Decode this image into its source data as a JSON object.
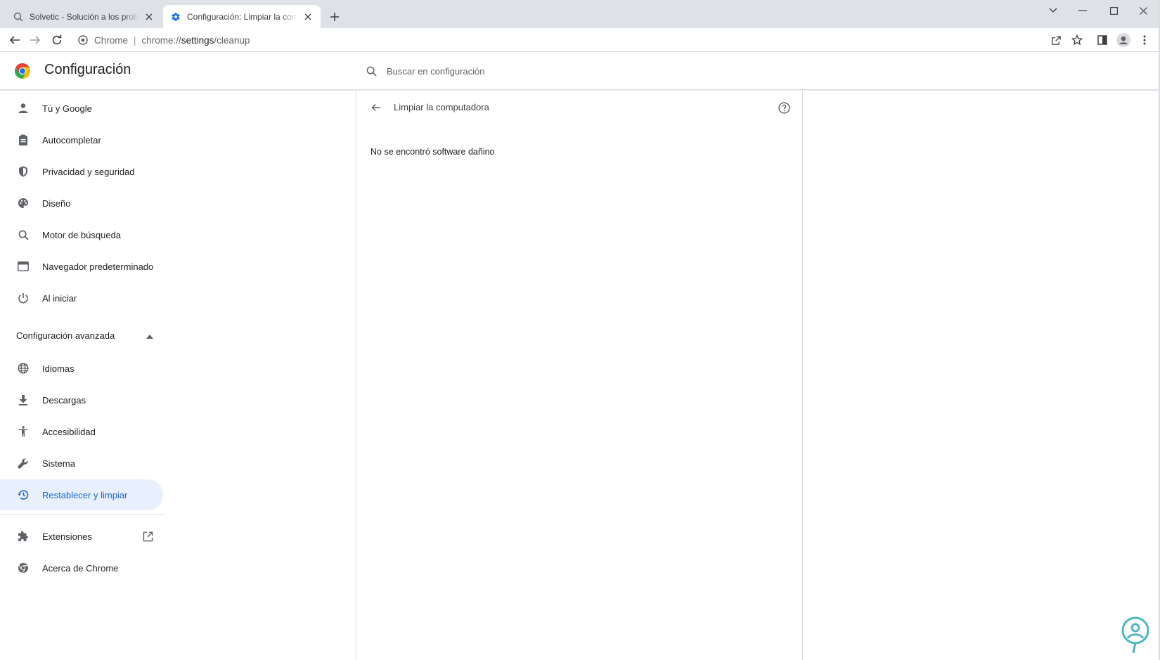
{
  "tabs": [
    {
      "title": "Solvetic - Solución a los problemas informáticos",
      "icon": "search-favicon-icon",
      "active": false
    },
    {
      "title": "Configuración: Limpiar la computadora",
      "icon": "gear-icon",
      "active": true
    }
  ],
  "toolbar": {
    "site_label": "Chrome",
    "url_scheme": "chrome://",
    "url_host": "settings",
    "url_path": "/cleanup"
  },
  "header": {
    "title": "Configuración",
    "search_placeholder": "Buscar en configuración"
  },
  "sidebar": {
    "items": [
      {
        "label": "Tú y Google",
        "icon": "person-icon"
      },
      {
        "label": "Autocompletar",
        "icon": "clipboard-icon"
      },
      {
        "label": "Privacidad y seguridad",
        "icon": "shield-icon"
      },
      {
        "label": "Diseño",
        "icon": "palette-icon"
      },
      {
        "label": "Motor de búsqueda",
        "icon": "search-icon"
      },
      {
        "label": "Navegador predeterminado",
        "icon": "browser-icon"
      },
      {
        "label": "Al iniciar",
        "icon": "power-icon"
      }
    ],
    "advanced_label": "Configuración avanzada",
    "advanced_items": [
      {
        "label": "Idiomas",
        "icon": "globe-icon"
      },
      {
        "label": "Descargas",
        "icon": "download-icon"
      },
      {
        "label": "Accesibilidad",
        "icon": "accessibility-icon"
      },
      {
        "label": "Sistema",
        "icon": "wrench-icon"
      },
      {
        "label": "Restablecer y limpiar",
        "icon": "restore-icon",
        "selected": true
      }
    ],
    "footer_items": [
      {
        "label": "Extensiones",
        "icon": "puzzle-icon"
      },
      {
        "label": "Acerca de Chrome",
        "icon": "chrome-icon"
      }
    ]
  },
  "main": {
    "subpage_title": "Limpiar la computadora",
    "status": "No se encontró software dañino"
  },
  "colors": {
    "accent": "#1a73e8",
    "selected_bg": "#e8f0fe",
    "tabstrip_bg": "#dee1e6"
  }
}
